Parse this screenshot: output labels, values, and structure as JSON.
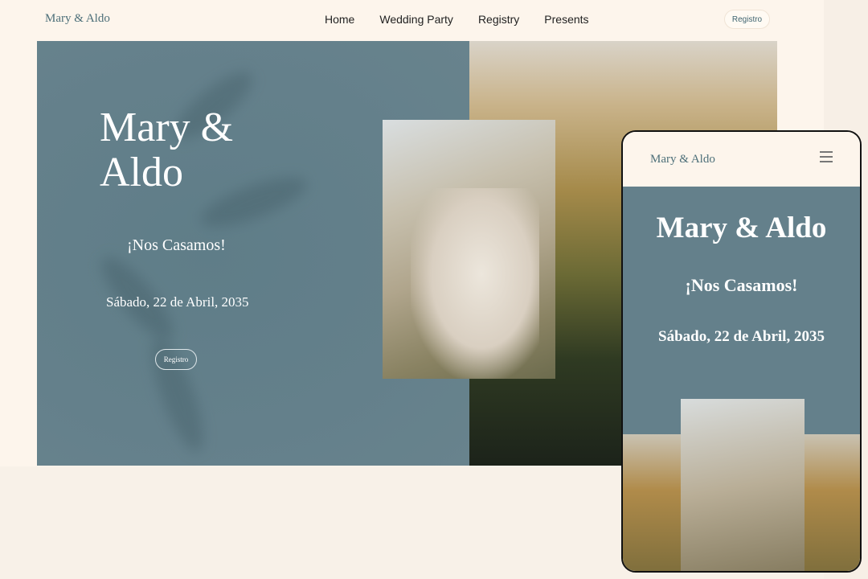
{
  "nav": {
    "logo": "Mary & Aldo",
    "items": [
      "Home",
      "Wedding Party",
      "Registry",
      "Presents"
    ],
    "cta": "Registro"
  },
  "hero": {
    "title_line1": "Mary &",
    "title_line2": "Aldo",
    "subtitle": "¡Nos Casamos!",
    "date": "Sábado, 22 de Abril, 2035",
    "button": "Registro"
  },
  "mobile": {
    "logo": "Mary & Aldo",
    "title": "Mary & Aldo",
    "subtitle": "¡Nos Casamos!",
    "date": "Sábado, 22 de Abril, 2035"
  }
}
